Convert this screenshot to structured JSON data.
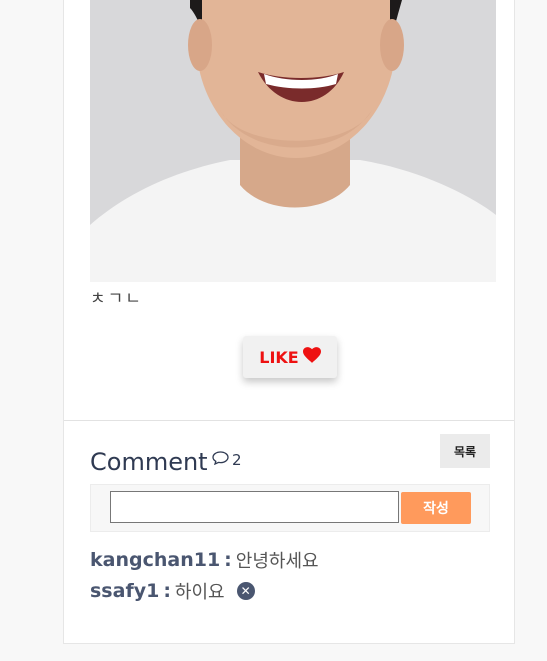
{
  "post": {
    "body": "ㅊㄱㄴ",
    "like_label": "LIKE",
    "like_icon": "heart-icon"
  },
  "comments_section": {
    "title": "Comment",
    "count": "2",
    "count_icon": "speech-bubble-icon",
    "list_button": "목록",
    "input_value": "",
    "input_placeholder": "",
    "submit_button": "작성",
    "items": [
      {
        "author": "kangchan11",
        "separator": ":",
        "text": "안녕하세요",
        "deletable": false
      },
      {
        "author": "ssafy1",
        "separator": ":",
        "text": "하이요",
        "deletable": true
      }
    ]
  },
  "colors": {
    "like": "#ee1111",
    "submit": "#ff9a5c",
    "author": "#4a5670"
  }
}
